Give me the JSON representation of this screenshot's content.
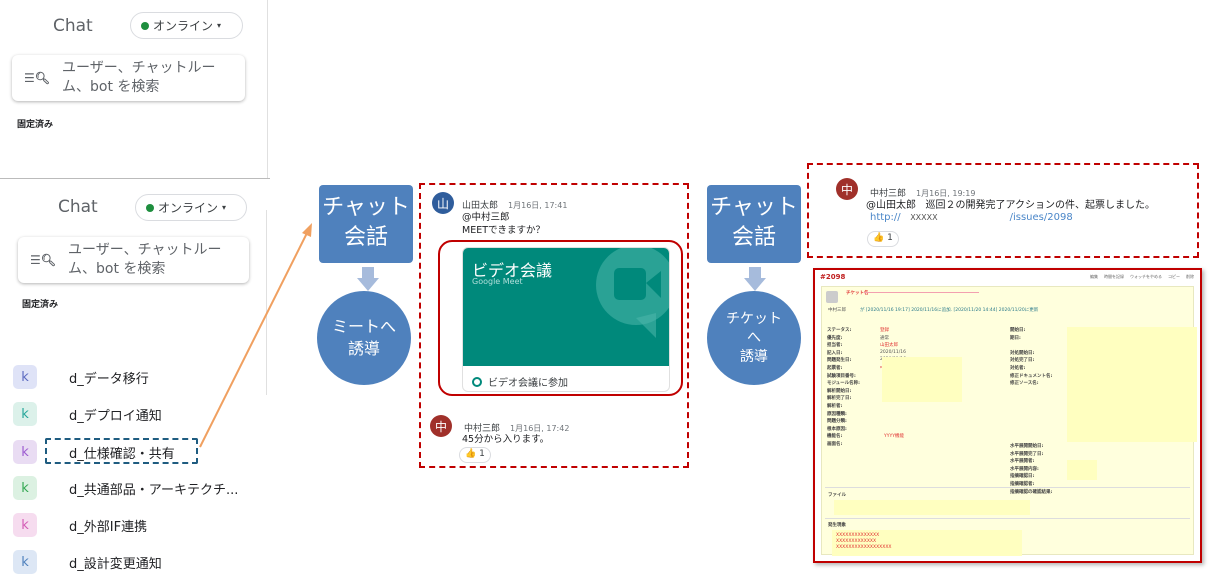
{
  "sidebar_top": {
    "title": "Chat",
    "status": "オンライン",
    "search_placeholder_line1": "ユーザー、チャットルー",
    "search_placeholder_line2": "ム、bot を検索",
    "pinned": "固定済み"
  },
  "sidebar_bottom": {
    "title": "Chat",
    "status": "オンライン",
    "search_placeholder_line1": "ユーザー、チャットルー",
    "search_placeholder_line2": "ム、bot を検索",
    "pinned": "固定済み",
    "rooms": [
      {
        "initial": "k",
        "name": "d_データ移行",
        "color": "#dfe3f7",
        "text": "#5c6bc0"
      },
      {
        "initial": "k",
        "name": "d_デプロイ通知",
        "color": "#dcf1ea",
        "text": "#26a69a"
      },
      {
        "initial": "k",
        "name": "d_仕様確認・共有",
        "color": "#e9dcf3",
        "text": "#9c5bd1"
      },
      {
        "initial": "k",
        "name": "d_共通部品・アーキテクチ...",
        "color": "#dcf1e2",
        "text": "#34a853"
      },
      {
        "initial": "k",
        "name": "d_外部IF連携",
        "color": "#f6dcef",
        "text": "#d35bb5"
      },
      {
        "initial": "k",
        "name": "d_設計変更通知",
        "color": "#dde7f5",
        "text": "#4f81bd"
      }
    ]
  },
  "flow1": {
    "box_line1": "チャット",
    "box_line2": "会話",
    "circle_line1": "ミートへ",
    "circle_line2": "誘導"
  },
  "flow2": {
    "box_line1": "チャット",
    "box_line2": "会話",
    "circle_line1": "チケット",
    "circle_line2": "へ",
    "circle_line3": "誘導"
  },
  "conversation1": {
    "msg1": {
      "avatar": "山",
      "author": "山田太郎",
      "time": "1月16日, 17:41",
      "mention": "@中村三郎",
      "text": "MEETできますか？"
    },
    "meet_card": {
      "title": "ビデオ会議",
      "subtitle": "Google Meet",
      "join": "ビデオ会議に参加",
      "color": "#00897b"
    },
    "msg2": {
      "avatar": "中",
      "author": "中村三郎",
      "time": "1月16日, 17:42",
      "text": "45分から入ります。",
      "reaction": "👍",
      "reaction_count": "1"
    }
  },
  "conversation2": {
    "avatar": "中",
    "author": "中村三郎",
    "time": "1月16日, 19:19",
    "mention": "@山田太郎",
    "text": "巡回２の開発完了アクションの件、起票しました。",
    "link_prefix": "http://",
    "link_mid": "XXXXX",
    "link_suffix": "/issues/2098",
    "reaction": "👍",
    "reaction_count": "1"
  },
  "ticket": {
    "id": "#2098",
    "actions": [
      "編集",
      "時間を記録",
      "ウォッチをやめる",
      "コピー",
      "削除"
    ],
    "subject": "チケット名",
    "author": "中村三郎",
    "history": "が [2020/11/16 19:17] 2020/11/16に追加. [2020/11/20 14:44] 2020/11/20に更新",
    "left_fields": [
      {
        "label": "ステータス:",
        "value": "登録",
        "red": true
      },
      {
        "label": "優先度:",
        "value": "通常"
      },
      {
        "label": "担当者:",
        "value": "山田太郎",
        "red": true
      },
      {
        "label": "記入日:",
        "value": "2020/11/16"
      },
      {
        "label": "問題発生日:",
        "value": "2020/11/16"
      },
      {
        "label": "起票者:",
        "value": "中村三郎",
        "red": true
      },
      {
        "label": "試験項目番号:",
        "value": ""
      },
      {
        "label": "モジュール名称:",
        "value": ""
      },
      {
        "label": "解析開始日:",
        "value": ""
      },
      {
        "label": "解析完了日:",
        "value": ""
      },
      {
        "label": "解析者:",
        "value": ""
      },
      {
        "label": "原因種類:",
        "value": ""
      },
      {
        "label": "問題分類:",
        "value": ""
      },
      {
        "label": "根本原因:",
        "value": ""
      },
      {
        "label": "機能名:",
        "value": "YYYY機能",
        "red": true
      },
      {
        "label": "画面名:",
        "value": ""
      }
    ],
    "right_fields": [
      "開始日:",
      "期日:",
      "",
      "対処開始日:",
      "対処完了日:",
      "対処者:",
      "修正ドキュメント名:",
      "修正ソース名:"
    ],
    "right_fields2": [
      "水平展開開始日:",
      "水平展開完了日:",
      "水平展開者:",
      "水平展開内容:",
      "指摘確認日:",
      "指摘確認者:",
      "指摘確認の確認結果:"
    ],
    "files_label": "ファイル",
    "phenomenon_label": "発生現象",
    "phenomenon_lines": [
      "XXXXXXXXXXXXXX",
      "XXXXXXXXXXXXX",
      "XXXXXXXXXXXXXXXXXX"
    ]
  }
}
